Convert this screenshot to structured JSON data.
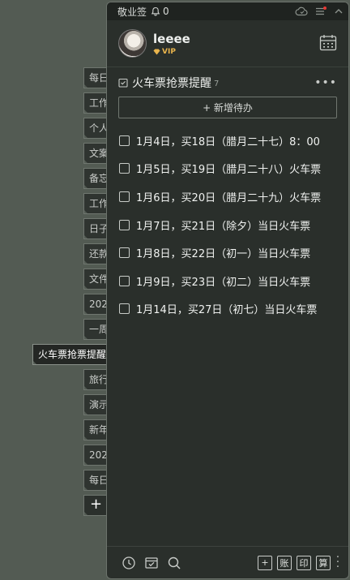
{
  "side_tabs": [
    {
      "label": "每日",
      "active": false
    },
    {
      "label": "工作",
      "active": false
    },
    {
      "label": "个人",
      "active": false
    },
    {
      "label": "文案",
      "active": false
    },
    {
      "label": "备忘",
      "active": false
    },
    {
      "label": "工作",
      "active": false
    },
    {
      "label": "日子",
      "active": false
    },
    {
      "label": "还款",
      "active": false
    },
    {
      "label": "文件",
      "active": false
    },
    {
      "label": "202",
      "active": false
    },
    {
      "label": "一周",
      "active": false
    },
    {
      "label": "火车票抢票提醒",
      "active": true
    },
    {
      "label": "旅行",
      "active": false
    },
    {
      "label": "演示",
      "active": false
    },
    {
      "label": "新年",
      "active": false
    },
    {
      "label": "202",
      "active": false
    },
    {
      "label": "每日",
      "active": false
    }
  ],
  "add_tab_label": "+",
  "topbar": {
    "brand": "敬业签",
    "bell_count": "0",
    "icons": [
      "cloud-sync-icon",
      "menu-icon",
      "collapse-chevron-icon"
    ]
  },
  "profile": {
    "username": "leeee",
    "vip_label": "VIP"
  },
  "list": {
    "title": "火车票抢票提醒",
    "count": "7",
    "add_label": "+ 新增待办",
    "items": [
      "1月4日，买18日（腊月二十七）8：00",
      "1月5日，买19日（腊月二十八）火车票",
      "1月6日，买20日（腊月二十九）火车票",
      "1月7日，买21日（除夕）当日火车票",
      "1月8日，买22日（初一）当日火车票",
      "1月9日，买23日（初二）当日火车票",
      "1月14日，买27日（初七）当日火车票"
    ]
  },
  "bottom": {
    "left_icons": [
      "clock-icon",
      "inbox-check-icon",
      "search-icon"
    ],
    "buttons": [
      "+",
      "账",
      "印",
      "算"
    ]
  },
  "colors": {
    "background": "#535b53",
    "panel": "#2a2f2b",
    "vip": "#e9b44c",
    "notify_dot": "#e53935"
  }
}
